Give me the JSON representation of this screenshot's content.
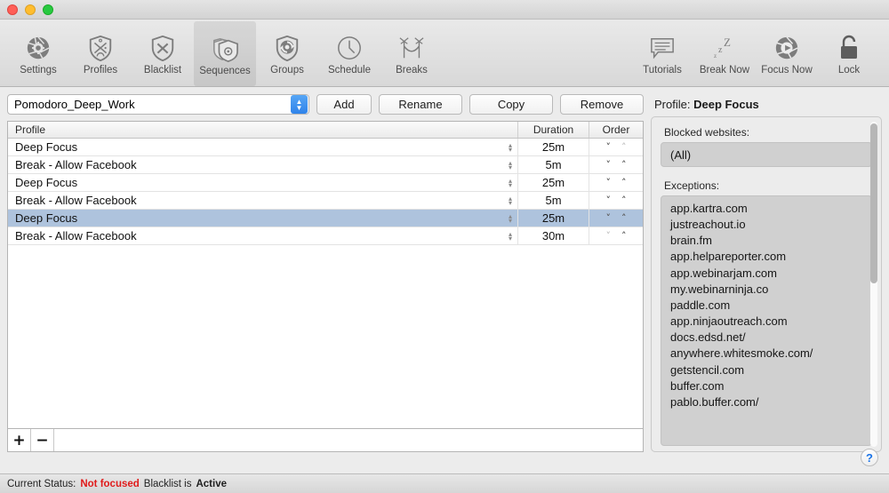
{
  "titlebar": {
    "buttons": [
      "close",
      "minimize",
      "zoom"
    ]
  },
  "toolbar": {
    "left_items": [
      {
        "label": "Settings",
        "icon": "aperture-gear-icon",
        "selected": false
      },
      {
        "label": "Profiles",
        "icon": "shield-profiles-icon",
        "selected": false
      },
      {
        "label": "Blacklist",
        "icon": "shield-x-icon",
        "selected": false
      },
      {
        "label": "Sequences",
        "icon": "stacked-shields-icon",
        "selected": true
      },
      {
        "label": "Groups",
        "icon": "shield-refresh-icon",
        "selected": false
      },
      {
        "label": "Schedule",
        "icon": "clock-icon",
        "selected": false
      },
      {
        "label": "Breaks",
        "icon": "hammock-palms-icon",
        "selected": false
      }
    ],
    "right_items": [
      {
        "label": "Tutorials",
        "icon": "speech-lines-icon"
      },
      {
        "label": "Break Now",
        "icon": "zzz-icon"
      },
      {
        "label": "Focus Now",
        "icon": "aperture-play-icon"
      },
      {
        "label": "Lock",
        "icon": "padlock-icon"
      }
    ]
  },
  "sequence_selector": {
    "value": "Pomodoro_Deep_Work",
    "stepper_icon": "chevron-up-down-icon",
    "buttons": [
      {
        "label": "Add"
      },
      {
        "label": "Rename"
      },
      {
        "label": "Copy"
      },
      {
        "label": "Remove"
      }
    ]
  },
  "table": {
    "columns": [
      "Profile",
      "Duration",
      "Order"
    ],
    "rows": [
      {
        "profile": "Deep Focus",
        "duration": "25m",
        "selected": false,
        "can_move_down": true,
        "can_move_up": false
      },
      {
        "profile": "Break - Allow Facebook",
        "duration": "5m",
        "selected": false,
        "can_move_down": true,
        "can_move_up": true
      },
      {
        "profile": "Deep Focus",
        "duration": "25m",
        "selected": false,
        "can_move_down": true,
        "can_move_up": true
      },
      {
        "profile": "Break - Allow Facebook",
        "duration": "5m",
        "selected": false,
        "can_move_down": true,
        "can_move_up": true
      },
      {
        "profile": "Deep Focus",
        "duration": "25m",
        "selected": true,
        "can_move_down": true,
        "can_move_up": true
      },
      {
        "profile": "Break - Allow Facebook",
        "duration": "30m",
        "selected": false,
        "can_move_down": false,
        "can_move_up": true
      }
    ],
    "footer": {
      "add_label": "+",
      "remove_label": "−"
    }
  },
  "detail": {
    "title_prefix": "Profile:",
    "title_value": "Deep Focus",
    "blocked_label": "Blocked websites:",
    "blocked_items": [
      "(All)"
    ],
    "exceptions_label": "Exceptions:",
    "exceptions": [
      "app.kartra.com",
      "justreachout.io",
      "brain.fm",
      "app.helpareporter.com",
      "app.webinarjam.com",
      "my.webinarninja.co",
      "paddle.com",
      "app.ninjaoutreach.com",
      "docs.edsd.net/",
      "anywhere.whitesmoke.com/",
      "getstencil.com",
      "buffer.com",
      "pablo.buffer.com/"
    ]
  },
  "help": {
    "label": "?"
  },
  "statusbar": {
    "prefix": "Current Status:",
    "status": "Not focused",
    "blacklist_prefix": "Blacklist is",
    "blacklist_state": "Active"
  },
  "colors": {
    "accent_blue": "#2f83ea",
    "selection_blue": "#aec3dd",
    "status_red": "#e01b1b",
    "help_blue": "#1a73e8",
    "toolbar_icon_gray": "#7d7d7d"
  }
}
